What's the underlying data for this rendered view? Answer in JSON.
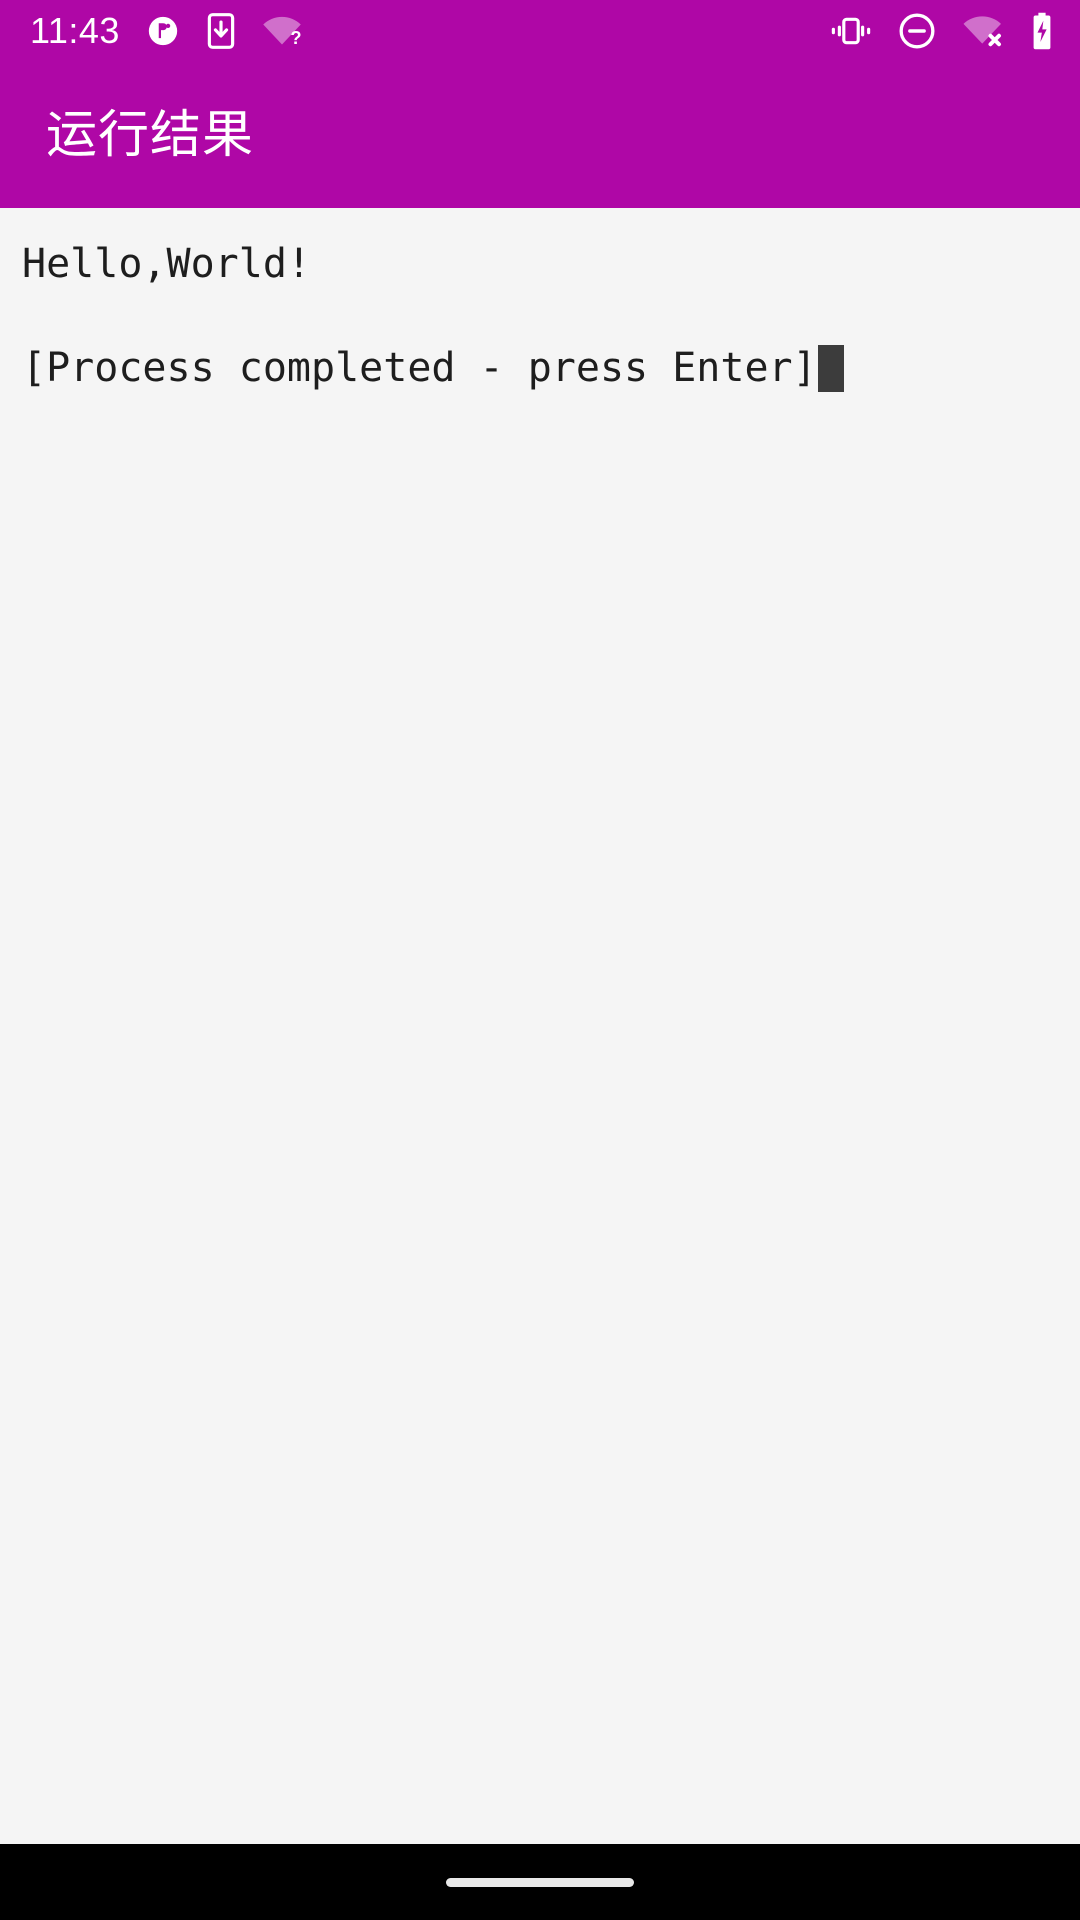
{
  "status_bar": {
    "time": "11:43",
    "left_icons": [
      {
        "name": "app-notification-icon",
        "label": "notification"
      },
      {
        "name": "phone-download-icon",
        "label": "download to device"
      },
      {
        "name": "wifi-unknown-icon",
        "label": "wifi unknown"
      }
    ],
    "right_icons": [
      {
        "name": "vibrate-icon",
        "label": "vibrate"
      },
      {
        "name": "do-not-disturb-icon",
        "label": "do not disturb"
      },
      {
        "name": "wifi-disconnected-icon",
        "label": "wifi disconnected"
      },
      {
        "name": "battery-charging-icon",
        "label": "battery charging"
      }
    ]
  },
  "app_bar": {
    "title": "运行结果",
    "background_color": "#AF07A6",
    "text_color": "#FFFFFF"
  },
  "console": {
    "background_color": "#F5F5F5",
    "text_color": "#1E1E1E",
    "cursor_color": "#3C3C3C",
    "lines": [
      "Hello,World!",
      "[Process completed - press Enter]"
    ],
    "line_1": "Hello,World!",
    "line_2": "[Process completed - press Enter]"
  },
  "navigation_bar": {
    "background_color": "#000000",
    "gesture_pill_color": "#E8E8E8"
  }
}
